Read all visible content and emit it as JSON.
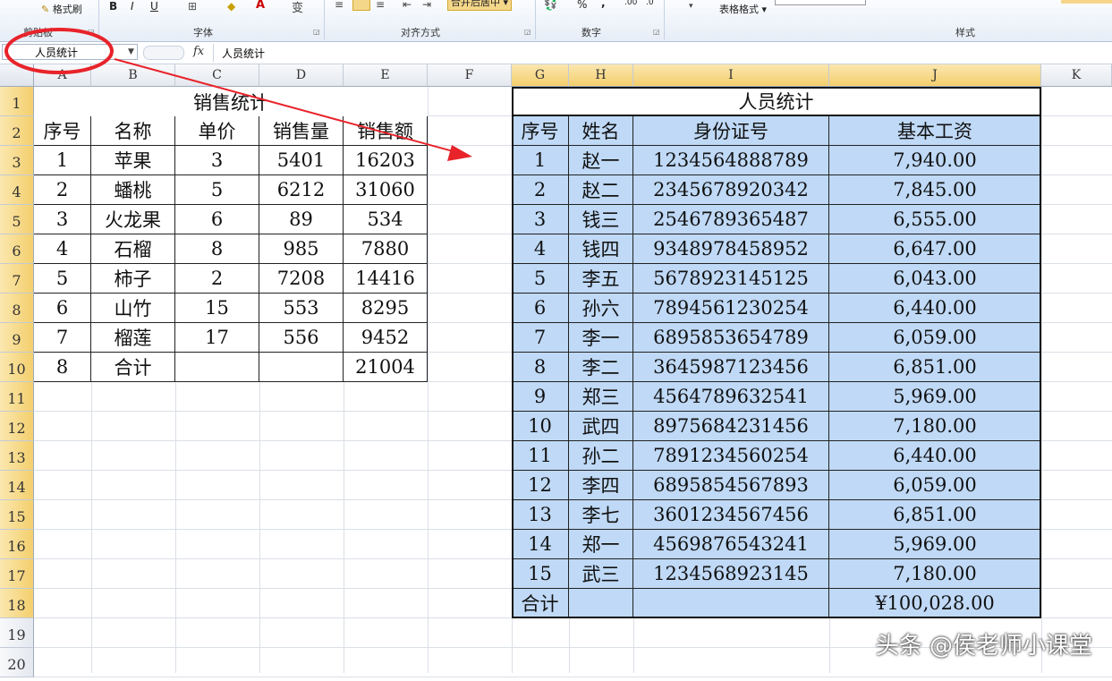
{
  "ribbon": {
    "format_painter": "格式刷",
    "bold": "B",
    "italic": "I",
    "underline": "U",
    "table_format": "表格格式",
    "merge_center": "合并后居中",
    "percent": "%",
    "comma": ",",
    "inc_decimal": ".00",
    "dec_decimal": ".0",
    "groups": {
      "clipboard": "剪贴板",
      "font": "字体",
      "alignment": "对齐方式",
      "number": "数字",
      "styles": "样式"
    }
  },
  "formula_bar": {
    "name_box": "人员统计",
    "fx": "fx",
    "value": "人员统计"
  },
  "columns": [
    "A",
    "B",
    "C",
    "D",
    "E",
    "F",
    "G",
    "H",
    "I",
    "J",
    "K"
  ],
  "rows": [
    "1",
    "2",
    "3",
    "4",
    "5",
    "6",
    "7",
    "8",
    "9",
    "10",
    "11",
    "12",
    "13",
    "14",
    "15",
    "16",
    "17",
    "18",
    "19",
    "20"
  ],
  "sales": {
    "title": "销售统计",
    "headers": [
      "序号",
      "名称",
      "单价",
      "销售量",
      "销售额"
    ],
    "rows": [
      [
        "1",
        "苹果",
        "3",
        "5401",
        "16203"
      ],
      [
        "2",
        "蟠桃",
        "5",
        "6212",
        "31060"
      ],
      [
        "3",
        "火龙果",
        "6",
        "89",
        "534"
      ],
      [
        "4",
        "石榴",
        "8",
        "985",
        "7880"
      ],
      [
        "5",
        "柿子",
        "2",
        "7208",
        "14416"
      ],
      [
        "6",
        "山竹",
        "15",
        "553",
        "8295"
      ],
      [
        "7",
        "榴莲",
        "17",
        "556",
        "9452"
      ],
      [
        "8",
        "合计",
        "",
        "",
        "21004"
      ]
    ]
  },
  "staff": {
    "title": "人员统计",
    "headers": [
      "序号",
      "姓名",
      "身份证号",
      "基本工资"
    ],
    "rows": [
      [
        "1",
        "赵一",
        "1234564888789",
        "7,940.00"
      ],
      [
        "2",
        "赵二",
        "2345678920342",
        "7,845.00"
      ],
      [
        "3",
        "钱三",
        "2546789365487",
        "6,555.00"
      ],
      [
        "4",
        "钱四",
        "9348978458952",
        "6,647.00"
      ],
      [
        "5",
        "李五",
        "5678923145125",
        "6,043.00"
      ],
      [
        "6",
        "孙六",
        "7894561230254",
        "6,440.00"
      ],
      [
        "7",
        "李一",
        "6895853654789",
        "6,059.00"
      ],
      [
        "8",
        "李二",
        "3645987123456",
        "6,851.00"
      ],
      [
        "9",
        "郑三",
        "4564789632541",
        "5,969.00"
      ],
      [
        "10",
        "武四",
        "8975684231456",
        "7,180.00"
      ],
      [
        "11",
        "孙二",
        "7891234560254",
        "6,440.00"
      ],
      [
        "12",
        "李四",
        "6895854567893",
        "6,059.00"
      ],
      [
        "13",
        "李七",
        "3601234567456",
        "6,851.00"
      ],
      [
        "14",
        "郑一",
        "4569876543241",
        "5,969.00"
      ],
      [
        "15",
        "武三",
        "1234568923145",
        "7,180.00"
      ]
    ],
    "total_label": "合计",
    "total_value": "¥100,028.00"
  },
  "watermark": "头条 @侯老师小课堂",
  "colors": {
    "selection_fill": "#bfd9f6",
    "annotation_red": "#e8232a",
    "header_selected": "#f3cf6c"
  }
}
